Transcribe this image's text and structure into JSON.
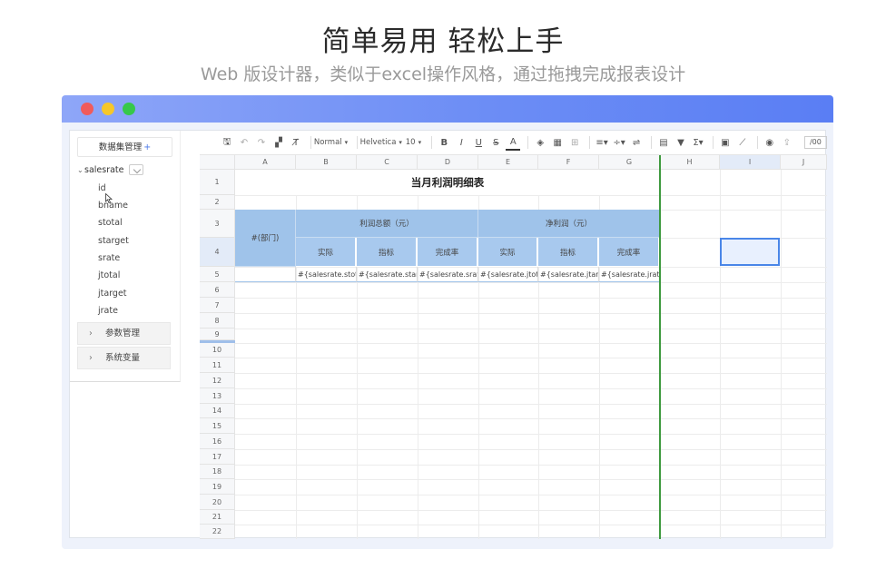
{
  "hero": {
    "title": "简单易用  轻松上手",
    "subtitle": "Web 版设计器，类似于excel操作风格，通过拖拽完成报表设计"
  },
  "sidebar": {
    "dataset_button": "数据集管理",
    "dataset_plus": "+",
    "root": "salesrate",
    "fields": [
      "id",
      "bname",
      "stotal",
      "starget",
      "srate",
      "jtotal",
      "jtarget",
      "jrate"
    ],
    "sections": [
      "参数管理",
      "系统变量"
    ]
  },
  "toolbar": {
    "style_select": "Normal",
    "font_select": "Helvetica",
    "size_select": "10",
    "zoom": "/00"
  },
  "sheet": {
    "columns": [
      "A",
      "B",
      "C",
      "D",
      "E",
      "F",
      "G",
      "H",
      "I",
      "J"
    ],
    "rows": [
      "1",
      "2",
      "3",
      "4",
      "5",
      "6",
      "7",
      "8",
      "9",
      "10",
      "11",
      "12",
      "13",
      "14",
      "15",
      "16",
      "17",
      "18",
      "19",
      "20",
      "21",
      "22"
    ],
    "title": "当月利润明细表",
    "dept_header": "#(部门)",
    "group1": "利润总额（元）",
    "group2": "净利润（元）",
    "sub_headers": [
      "实际",
      "指标",
      "完成率",
      "实际",
      "指标",
      "完成率"
    ],
    "data_row": [
      "#{salesrate.stotal}",
      "#{salesrate.starget}",
      "#{salesrate.srate}",
      "#{salesrate.jtotal}",
      "#{salesrate.jtarget}",
      "#{salesrate.jrate}"
    ]
  },
  "colors": {
    "header_blue": "#9fc3ea",
    "titlebar_start": "#8ea6f8",
    "titlebar_end": "#5a7ef4",
    "freeze_line": "#3f9a3f"
  }
}
